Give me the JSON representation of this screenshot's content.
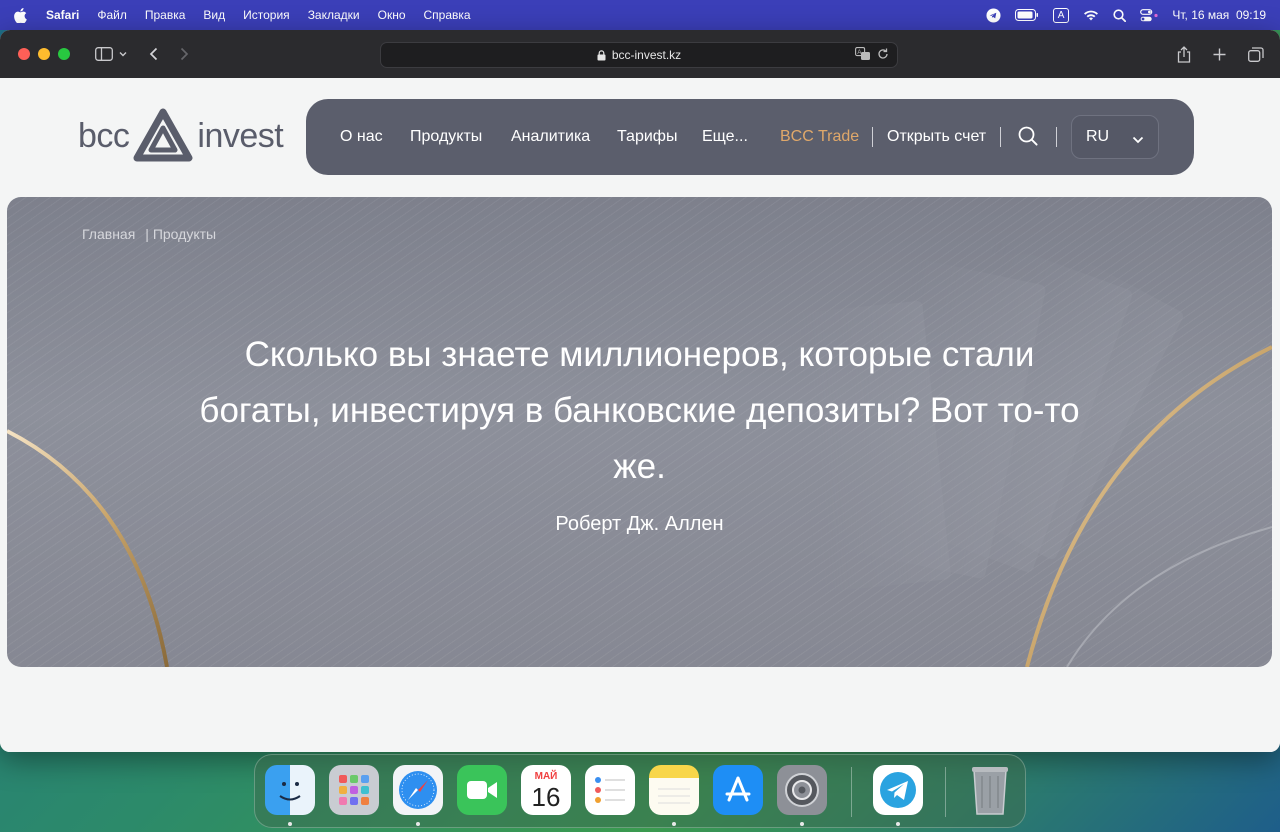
{
  "menubar": {
    "app": "Safari",
    "items": [
      "Файл",
      "Правка",
      "Вид",
      "История",
      "Закладки",
      "Окно",
      "Справка"
    ],
    "input_source": "A",
    "datetime": "Чт, 16 мая  09:19"
  },
  "browser": {
    "url": "bcc-invest.kz"
  },
  "site": {
    "logo_left": "bcc",
    "logo_right": "invest",
    "nav": {
      "about": "О нас",
      "products": "Продукты",
      "analytics": "Аналитика",
      "tariffs": "Тарифы",
      "more": "Еще...",
      "trade": "BCC Trade",
      "open_account": "Открыть счет",
      "language": "RU"
    },
    "colors": {
      "nav_bg": "#5b5e6c",
      "trade_accent": "#e0a86a"
    }
  },
  "hero": {
    "breadcrumb_home": "Главная",
    "breadcrumb_current": "| Продукты",
    "quote": "Сколько вы знаете миллионеров, которые стали богаты, инвестируя в банковские депозиты? Вот то-то же.",
    "author": "Роберт Дж. Аллен"
  },
  "dock": {
    "calendar_month": "МАЙ",
    "calendar_day": "16",
    "apps": [
      "finder-icon",
      "launchpad-icon",
      "safari-icon",
      "facetime-icon",
      "calendar-icon",
      "reminders-icon",
      "notes-icon",
      "app-store-icon",
      "system-settings-icon",
      "telegram-icon",
      "trash-icon"
    ]
  }
}
